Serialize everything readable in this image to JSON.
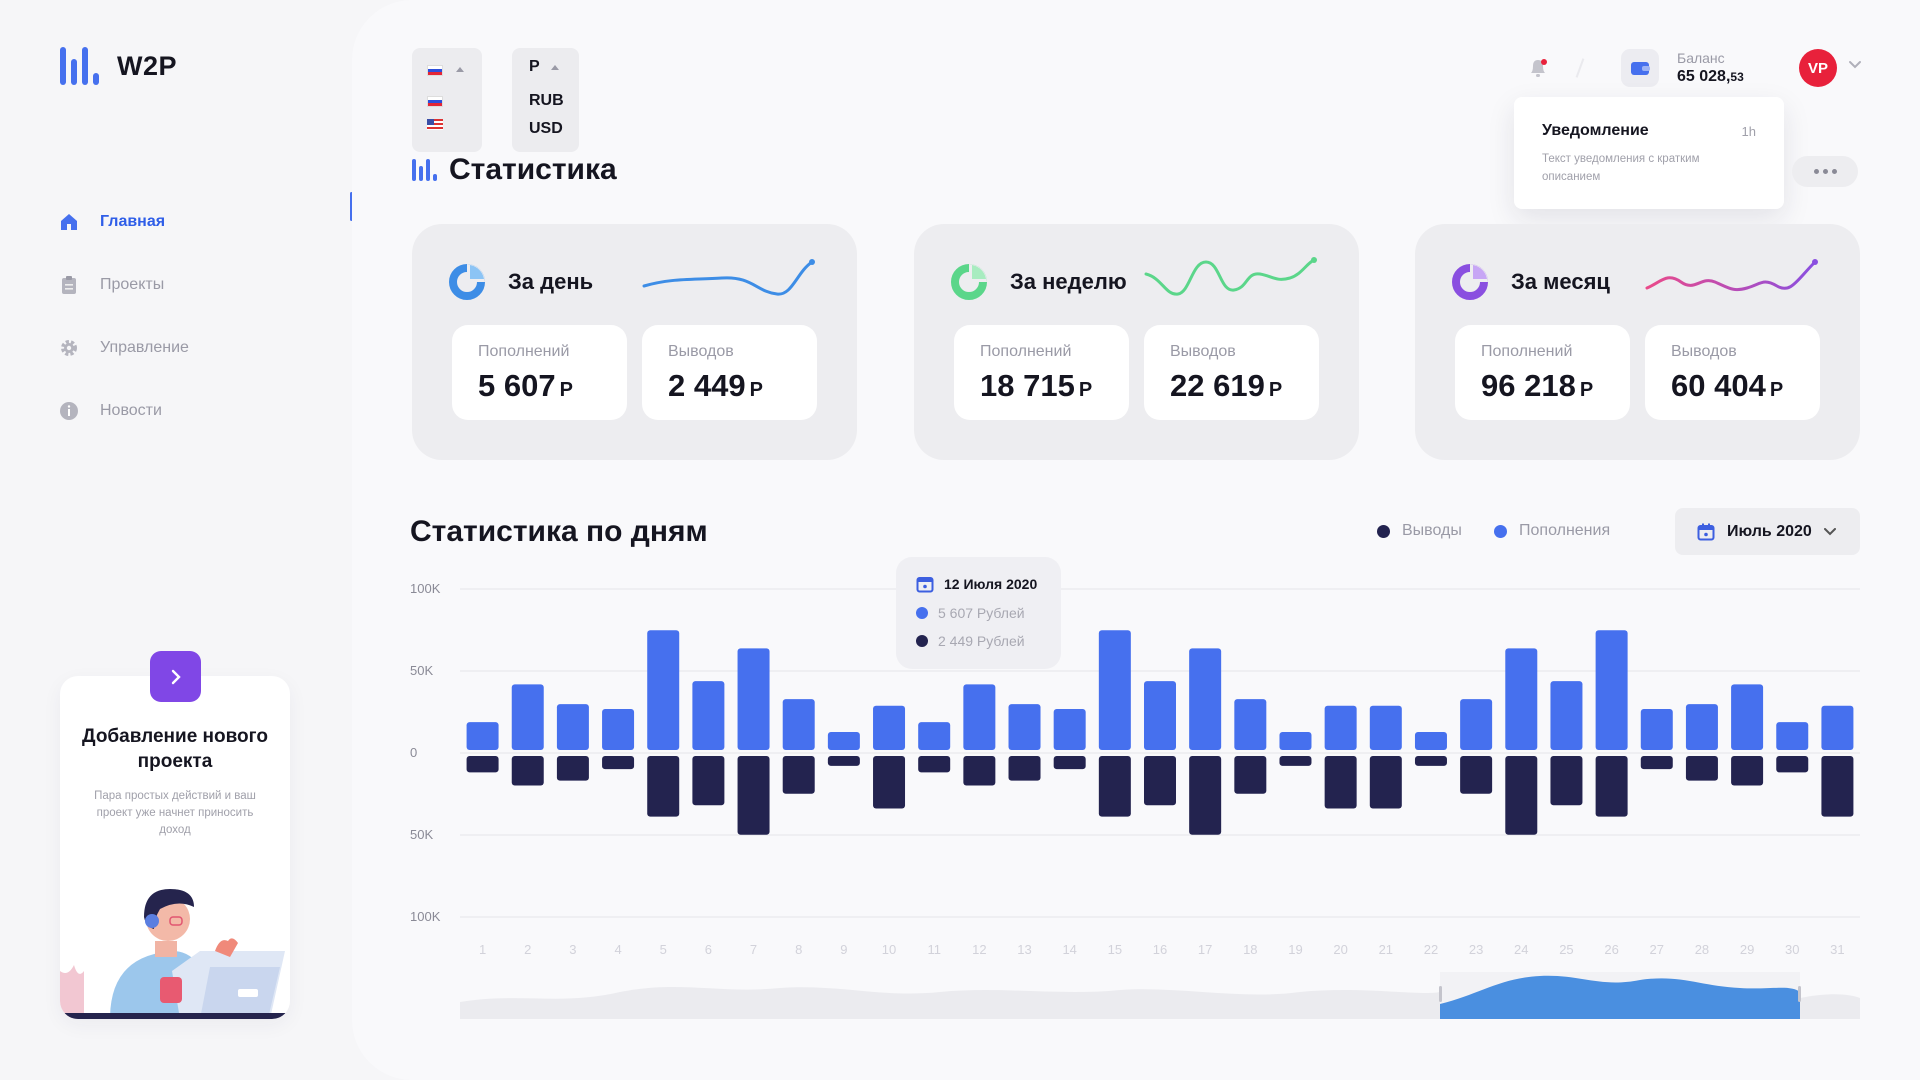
{
  "brand": {
    "name": "W2P"
  },
  "sidebar": {
    "items": [
      {
        "label": "Главная",
        "icon": "home-icon",
        "active": true
      },
      {
        "label": "Проекты",
        "icon": "clipboard-icon",
        "active": false
      },
      {
        "label": "Управление",
        "icon": "gear-icon",
        "active": false
      },
      {
        "label": "Новости",
        "icon": "info-icon",
        "active": false
      }
    ],
    "promo": {
      "title": "Добавление нового проекта",
      "subtitle": "Пара простых действий и ваш проект уже начнет приносить доход"
    }
  },
  "language_select": {
    "options": [
      "RU",
      "US"
    ]
  },
  "currency_select": {
    "selected": "Р",
    "options": [
      "RUB",
      "USD"
    ]
  },
  "page_title": "Статистика",
  "header": {
    "balance_label": "Баланс",
    "balance_main": "65 028,",
    "balance_cents": "53",
    "avatar_initials": "VP"
  },
  "notification": {
    "title": "Уведомление",
    "time": "1h",
    "text": "Текст уведомления с кратким описанием"
  },
  "stat_cards": [
    {
      "title": "За день",
      "deposits_label": "Пополнений",
      "deposits": "5 607",
      "withdrawals_label": "Выводов",
      "withdrawals": "2 449",
      "currency": "Р"
    },
    {
      "title": "За неделю",
      "deposits_label": "Пополнений",
      "deposits": "18 715",
      "withdrawals_label": "Выводов",
      "withdrawals": "22 619",
      "currency": "Р"
    },
    {
      "title": "За месяц",
      "deposits_label": "Пополнений",
      "deposits": "96 218",
      "withdrawals_label": "Выводов",
      "withdrawals": "60 404",
      "currency": "Р"
    }
  ],
  "chart_section": {
    "title": "Статистика по дням",
    "legend_withdrawals": "Выводы",
    "legend_deposits": "Пополнения",
    "month": "Июль 2020",
    "tooltip": {
      "date": "12 Июля 2020",
      "deposits": "5 607 Рублей",
      "withdrawals": "2 449 Рублей"
    }
  },
  "colors": {
    "accent": "#4670ee",
    "withdrawals": "#23234f",
    "promo": "#8047e6",
    "avatar": "#e8213b"
  },
  "chart_data": {
    "type": "bar",
    "y_ticks": [
      "100K",
      "50K",
      "0",
      "50K",
      "100K"
    ],
    "ylim": [
      -100000,
      100000
    ],
    "categories": [
      "1",
      "2",
      "3",
      "4",
      "5",
      "6",
      "7",
      "8",
      "9",
      "10",
      "11",
      "12",
      "13",
      "14",
      "15",
      "16",
      "17",
      "18",
      "19",
      "20",
      "21",
      "22",
      "23",
      "24",
      "25",
      "26",
      "27",
      "28",
      "29",
      "30",
      "31"
    ],
    "series": [
      {
        "name": "Пополнения",
        "values": [
          17000,
          40000,
          28000,
          25000,
          73000,
          42000,
          62000,
          31000,
          11000,
          27000,
          17000,
          40000,
          28000,
          25000,
          73000,
          42000,
          62000,
          31000,
          11000,
          27000,
          27000,
          11000,
          31000,
          62000,
          42000,
          73000,
          25000,
          28000,
          40000,
          17000,
          27000
        ]
      },
      {
        "name": "Выводы",
        "values": [
          -10000,
          -18000,
          -15000,
          -8000,
          -37000,
          -30000,
          -48000,
          -23000,
          -6000,
          -32000,
          -10000,
          -18000,
          -15000,
          -8000,
          -37000,
          -30000,
          -48000,
          -23000,
          -6000,
          -32000,
          -32000,
          -6000,
          -23000,
          -48000,
          -30000,
          -37000,
          -8000,
          -15000,
          -18000,
          -10000,
          -37000
        ]
      }
    ]
  }
}
